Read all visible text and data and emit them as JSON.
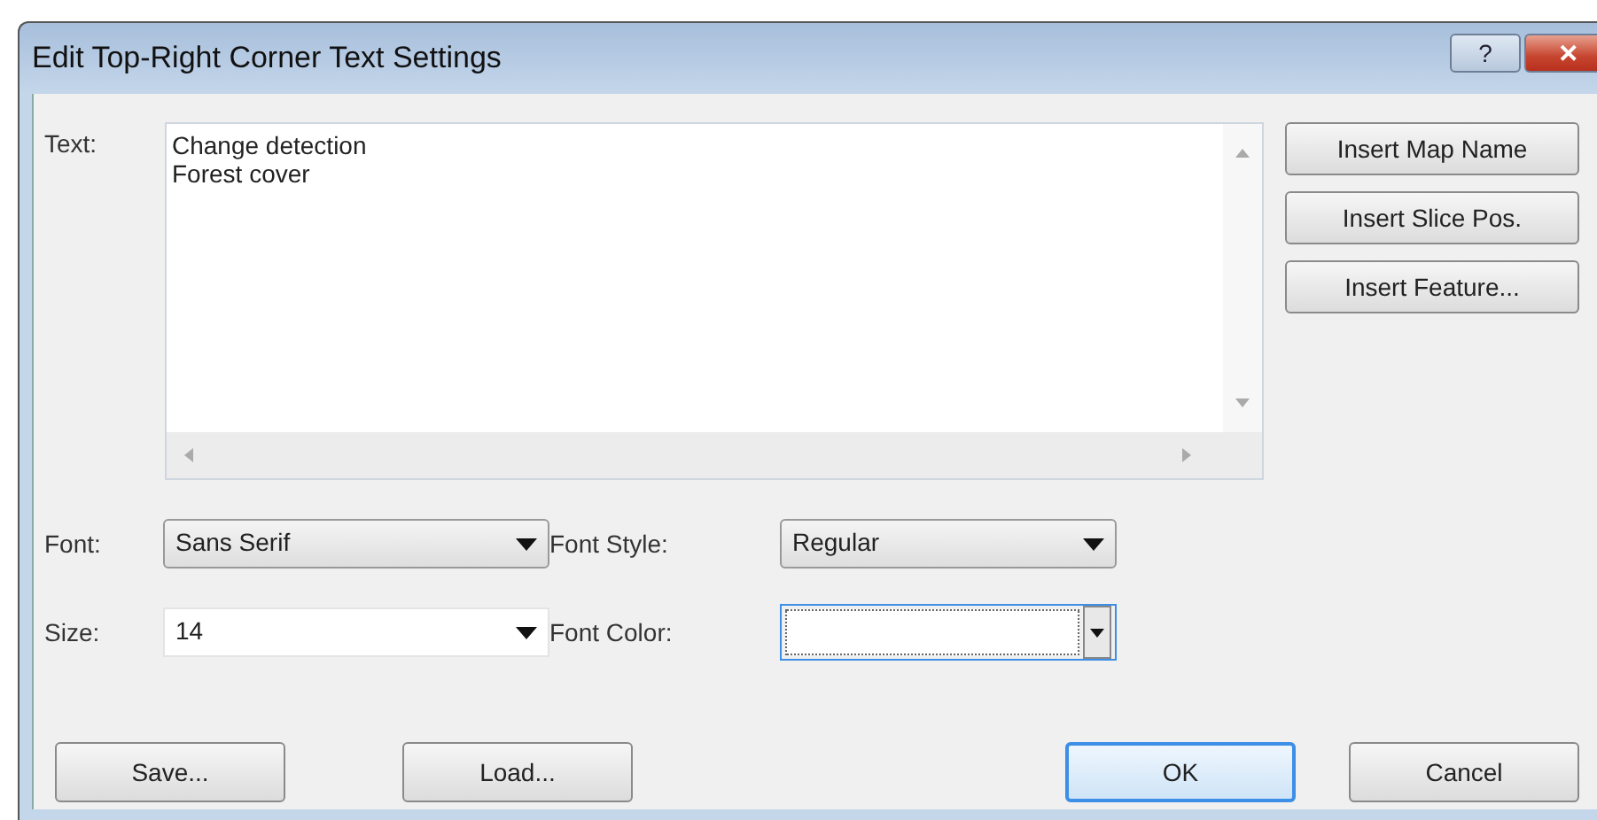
{
  "window": {
    "title": "Edit Top-Right Corner Text Settings",
    "help_button": "?",
    "close_button": "✕"
  },
  "text": {
    "label": "Text:",
    "lines": [
      "Change detection",
      "Forest cover"
    ]
  },
  "insert_buttons": [
    "Insert Map Name",
    "Insert Slice Pos.",
    "Insert Feature..."
  ],
  "font": {
    "label": "Font:",
    "value": "Sans Serif"
  },
  "font_style": {
    "label": "Font Style:",
    "value": "Regular"
  },
  "size": {
    "label": "Size:",
    "value": "14"
  },
  "font_color": {
    "label": "Font Color:",
    "color": "#ffffff",
    "focused": true
  },
  "buttons": [
    {
      "label": "Save...",
      "default": false
    },
    {
      "label": "Load...",
      "default": false
    },
    {
      "label": "OK",
      "default": true
    },
    {
      "label": "Cancel",
      "default": false
    }
  ]
}
